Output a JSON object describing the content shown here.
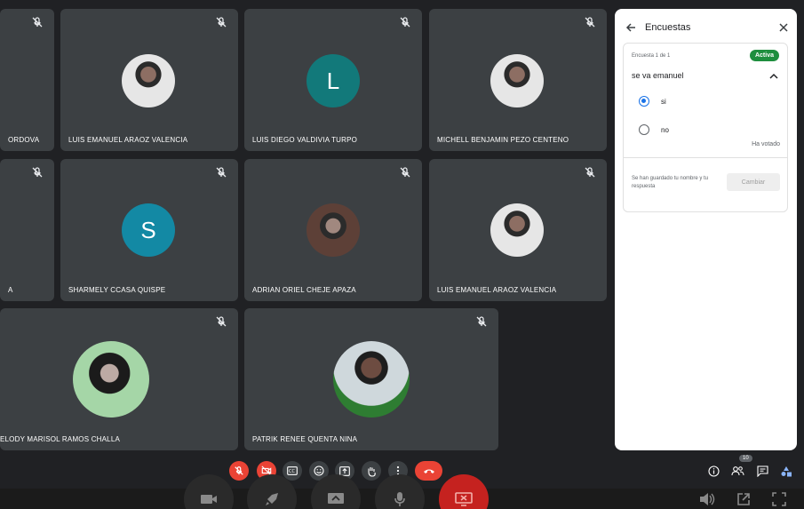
{
  "participants": [
    {
      "name": "ORDOVA"
    },
    {
      "name": "LUIS EMANUEL ARAOZ VALENCIA"
    },
    {
      "name": "LUIS DIEGO VALDIVIA TURPO",
      "initial": "L",
      "color": "#12797a"
    },
    {
      "name": "MICHELL BENJAMIN PEZO CENTENO"
    },
    {
      "name": "A"
    },
    {
      "name": "SHARMELY CCASA QUISPE",
      "initial": "S",
      "color": "#1389a4"
    },
    {
      "name": "ADRIAN ORIEL CHEJE APAZA"
    },
    {
      "name": "LUIS EMANUEL ARAOZ VALENCIA"
    },
    {
      "name": "ELODY MARISOL RAMOS CHALLA"
    },
    {
      "name": "PATRIK RENEE QUENTA NINA"
    }
  ],
  "panel": {
    "title": "Encuestas",
    "poll_number": "Encuesta 1 de 1",
    "status": "Activa",
    "question": "se va emanuel",
    "options": [
      {
        "label": "si",
        "selected": true
      },
      {
        "label": "no",
        "selected": false
      }
    ],
    "voted": "Ha votado",
    "saved_note": "Se han guardado tu nombre y tu respuesta",
    "change_button": "Cambiar"
  },
  "controls": {
    "participant_count": "10",
    "icons": [
      "mic-off-icon",
      "camera-off-icon",
      "captions-icon",
      "emoji-icon",
      "present-icon",
      "raise-hand-icon",
      "more-icon",
      "end-call-icon"
    ]
  },
  "colors": {
    "background": "#202124",
    "tile": "#3c4043",
    "danger": "#ea4335",
    "active": "#1e8e3e",
    "accent": "#1a73e8"
  }
}
